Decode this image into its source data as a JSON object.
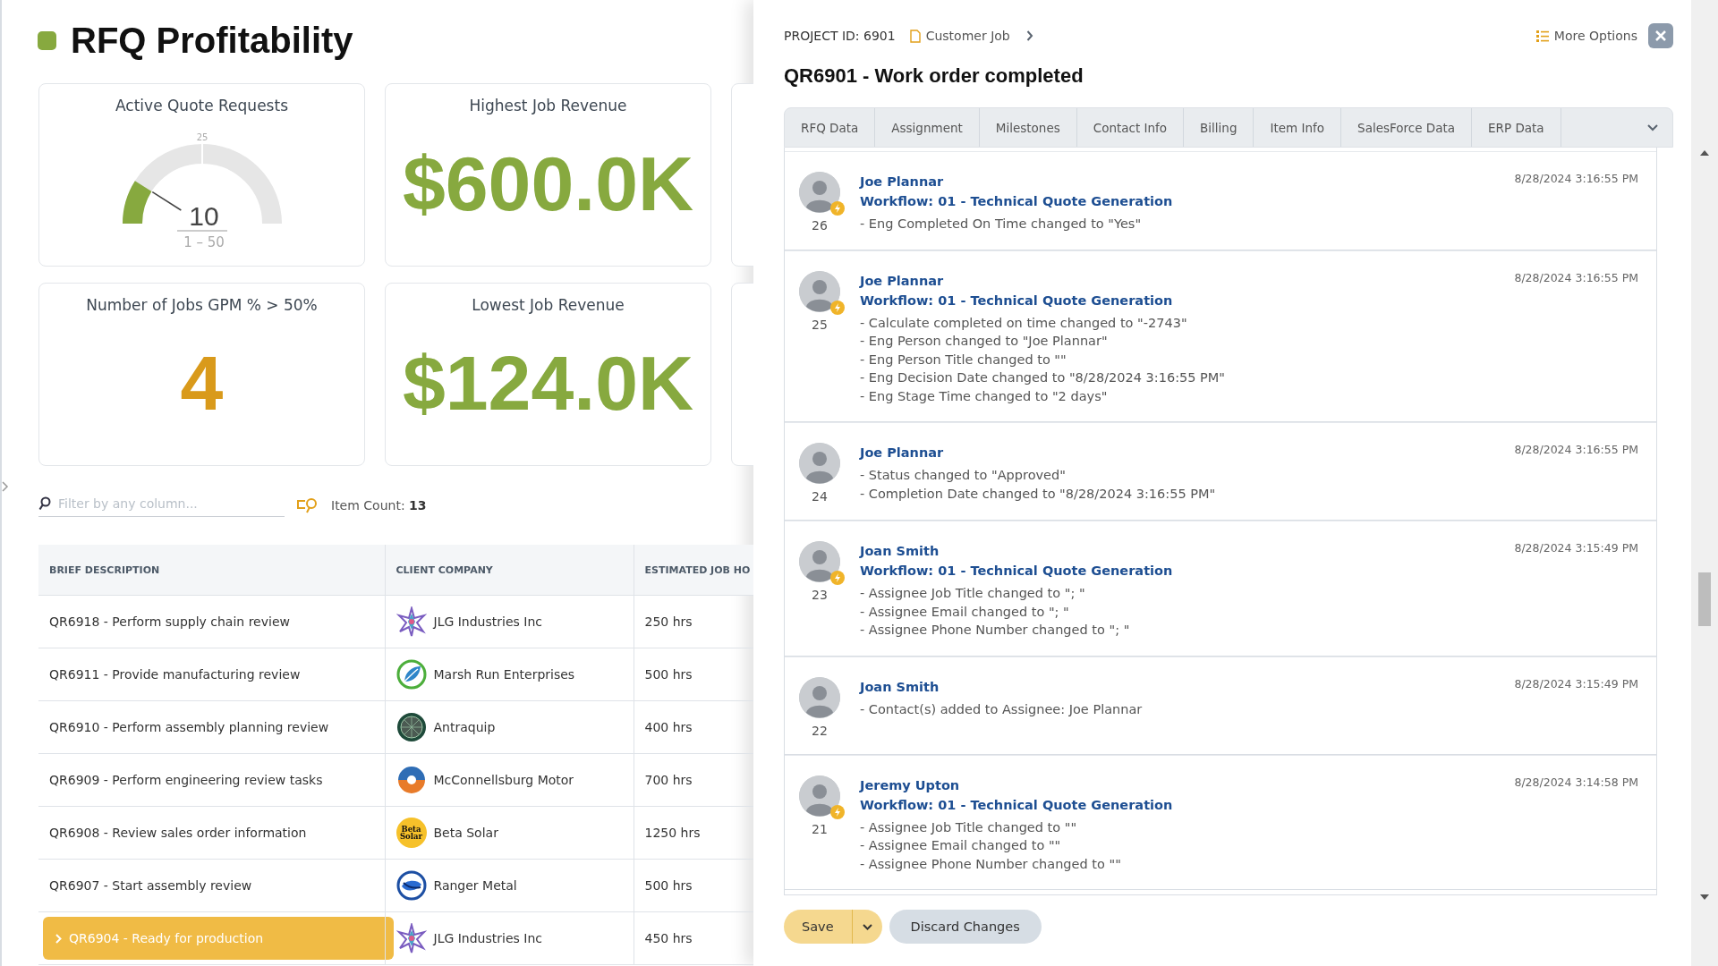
{
  "page": {
    "title": "RFQ Profitability"
  },
  "kpis": [
    {
      "kind": "gauge",
      "title": "Active Quote Requests",
      "value": "10",
      "range": "1 – 50",
      "tick": "25",
      "level": 0.18
    },
    {
      "kind": "number",
      "title": "Highest Job Revenue",
      "value": "$600.0K",
      "color": "#87a93f"
    },
    {
      "kind": "blank"
    },
    {
      "kind": "number",
      "title": "Number of Jobs GPM % > 50%",
      "value": "4",
      "color": "#d99a1b"
    },
    {
      "kind": "number",
      "title": "Lowest Job Revenue",
      "value": "$124.0K",
      "color": "#87a93f"
    },
    {
      "kind": "blank"
    }
  ],
  "filter": {
    "placeholder": "Filter by any column..."
  },
  "item_count": {
    "label": "Item Count:",
    "value": "13"
  },
  "table": {
    "columns": [
      "BRIEF DESCRIPTION",
      "CLIENT COMPANY",
      "ESTIMATED JOB HO"
    ],
    "rows": [
      {
        "description": "QR6918 - Perform supply chain review",
        "company": "JLG Industries Inc",
        "kind": "star",
        "hours": "250 hrs",
        "selected": false
      },
      {
        "description": "QR6911 - Provide manufacturing review",
        "company": "Marsh Run Enterprises",
        "kind": "leaf",
        "hours": "500 hrs",
        "selected": false
      },
      {
        "description": "QR6910 - Perform assembly planning review",
        "company": "Antraquip",
        "kind": "globe",
        "hours": "400 hrs",
        "selected": false
      },
      {
        "description": "QR6909 - Perform engineering review tasks",
        "company": "McConnellsburg Motor",
        "kind": "swirl",
        "hours": "700 hrs",
        "selected": false
      },
      {
        "description": "QR6908 - Review sales order information",
        "company": "Beta Solar",
        "kind": "sun",
        "logo_text": [
          "Beta",
          "Solar"
        ],
        "hours": "1250 hrs",
        "selected": false
      },
      {
        "description": "QR6907 - Start assembly review",
        "company": "Ranger Metal",
        "kind": "ring",
        "hours": "500 hrs",
        "selected": false
      },
      {
        "description": "QR6904 - Ready for production",
        "company": "JLG Industries Inc",
        "kind": "star",
        "hours": "450 hrs",
        "selected": true
      }
    ]
  },
  "panel": {
    "project_label": "PROJECT",
    "project_id": "ID: 6901",
    "breadcrumb": "Customer Job",
    "more_options": "More Options",
    "title": "QR6901 - Work order completed",
    "tabs": [
      {
        "label": "RFQ Data",
        "selected": false
      },
      {
        "label": "Assignment",
        "selected": false
      },
      {
        "label": "Milestones",
        "selected": false
      },
      {
        "label": "Contact Info",
        "selected": false
      },
      {
        "label": "Billing",
        "selected": false
      },
      {
        "label": "Item Info",
        "selected": false
      },
      {
        "label": "SalesForce Data",
        "selected": false
      },
      {
        "label": "ERP Data",
        "selected": false
      }
    ],
    "history": [
      {
        "author": "Joe Plannar",
        "number": "26",
        "badge": true,
        "time": "8/28/2024 3:16:55 PM",
        "workflow": "Workflow: 01 - Technical Quote Generation",
        "changes": [
          "- Eng Completed On Time changed to \"Yes\""
        ]
      },
      {
        "author": "Joe Plannar",
        "number": "25",
        "badge": true,
        "time": "8/28/2024 3:16:55 PM",
        "workflow": "Workflow: 01 - Technical Quote Generation",
        "changes": [
          "- Calculate completed on time changed to \"-2743\"",
          "- Eng Person changed to \"Joe Plannar\"",
          "- Eng Person Title changed to \"\"",
          "- Eng Decision Date changed to \"8/28/2024 3:16:55 PM\"",
          "- Eng Stage Time changed to \"2 days\""
        ]
      },
      {
        "author": "Joe Plannar",
        "number": "24",
        "badge": false,
        "time": "8/28/2024 3:16:55 PM",
        "changes": [
          "- Status changed to \"Approved\"",
          "- Completion Date changed to \"8/28/2024 3:16:55 PM\""
        ]
      },
      {
        "author": "Joan Smith",
        "number": "23",
        "badge": true,
        "time": "8/28/2024 3:15:49 PM",
        "workflow": "Workflow: 01 - Technical Quote Generation",
        "changes": [
          "- Assignee Job Title changed to \"; \"",
          "- Assignee Email changed to \"; \"",
          "- Assignee Phone Number changed to \"; \""
        ]
      },
      {
        "author": "Joan Smith",
        "number": "22",
        "badge": false,
        "time": "8/28/2024 3:15:49 PM",
        "changes": [
          "- Contact(s) added to Assignee: Joe Plannar"
        ]
      },
      {
        "author": "Jeremy Upton",
        "number": "21",
        "badge": true,
        "time": "8/28/2024 3:14:58 PM",
        "workflow": "Workflow: 01 - Technical Quote Generation",
        "changes": [
          "- Assignee Job Title changed to \"\"",
          "- Assignee Email changed to \"\"",
          "- Assignee Phone Number changed to \"\""
        ]
      }
    ],
    "save": "Save",
    "discard": "Discard Changes"
  }
}
